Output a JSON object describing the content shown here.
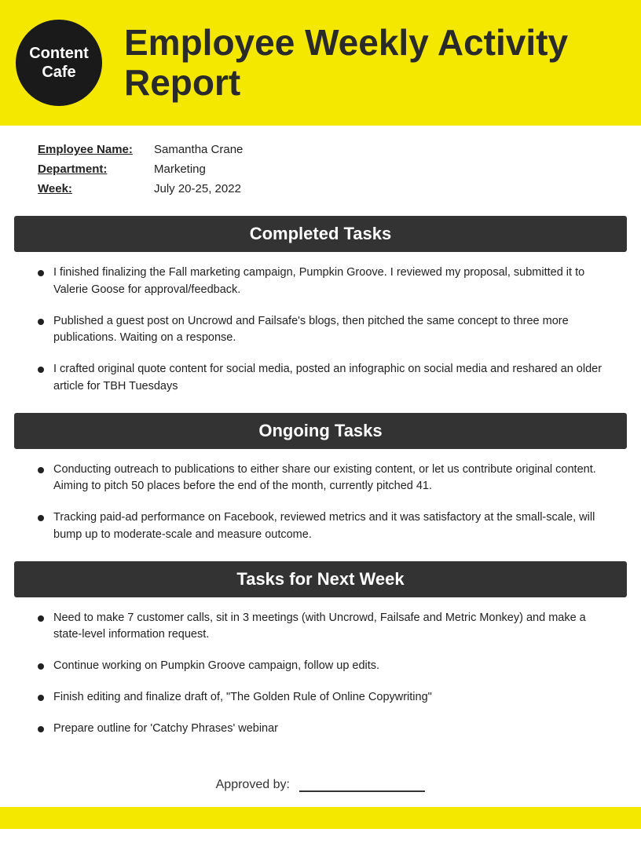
{
  "header": {
    "logo_line1": "Content",
    "logo_line2": "Cafe",
    "title": "Employee Weekly Activity Report",
    "brand_color": "#f5e800",
    "logo_bg": "#1a1a1a"
  },
  "info": {
    "employee_label": "Employee Name:",
    "employee_value": "Samantha Crane",
    "department_label": "Department:",
    "department_value": "Marketing",
    "week_label": "Week:",
    "week_value": "July 20-25, 2022"
  },
  "sections": {
    "completed": {
      "title": "Completed Tasks",
      "items": [
        "I finished finalizing the Fall marketing campaign, Pumpkin Groove. I reviewed my proposal, submitted it to Valerie Goose for approval/feedback.",
        "Published a guest post on Uncrowd and Failsafe's blogs, then pitched the same concept to three more publications. Waiting on a response.",
        "I crafted original quote content for social media, posted an infographic on social media and reshared an older article for TBH Tuesdays"
      ]
    },
    "ongoing": {
      "title": "Ongoing Tasks",
      "items": [
        "Conducting outreach to publications to either share our existing content, or let us contribute original content. Aiming to pitch 50 places before the end of the month, currently pitched 41.",
        "Tracking paid-ad performance on Facebook, reviewed metrics and it was satisfactory at the small-scale, will bump up to moderate-scale and measure outcome."
      ]
    },
    "next_week": {
      "title": "Tasks for Next Week",
      "items": [
        "Need to make 7 customer calls, sit in 3 meetings (with Uncrowd, Failsafe and Metric Monkey) and make a state-level information request.",
        "Continue working on Pumpkin Groove campaign, follow up edits.",
        "Finish editing and finalize draft of, \"The Golden Rule of Online Copywriting\"",
        "Prepare outline for 'Catchy Phrases' webinar"
      ]
    }
  },
  "approved": {
    "label": "Approved by:"
  }
}
